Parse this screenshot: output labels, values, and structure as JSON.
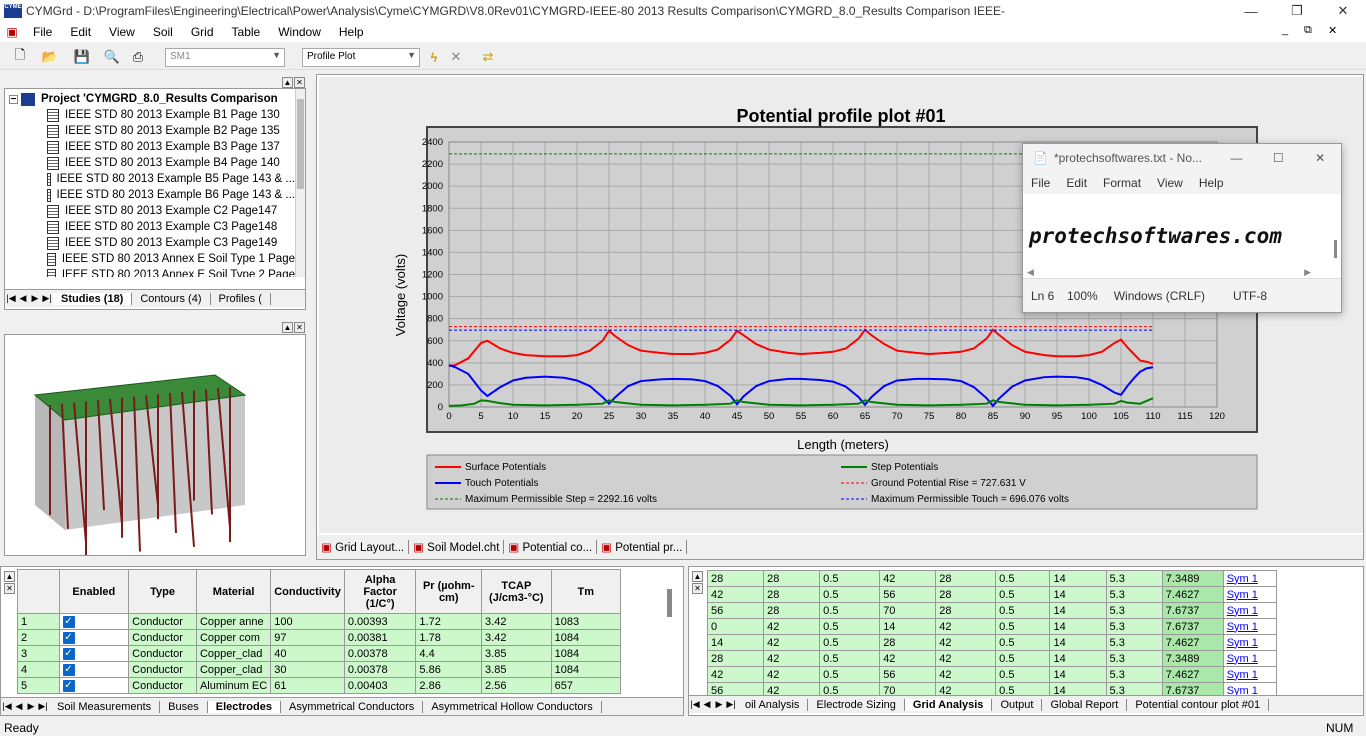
{
  "window": {
    "title": "CYMGrd - D:\\ProgramFiles\\Engineering\\Electrical\\Power\\Analysis\\Cyme\\CYMGRD\\V8.0Rev01\\CYMGRD-IEEE-80 2013 Results Comparison\\CYMGRD_8.0_Results Comparison IEEE-",
    "minimize": "—",
    "maximize": "❐",
    "close": "✕",
    "app_icon_text": "CYME"
  },
  "menu": [
    "File",
    "Edit",
    "View",
    "Soil",
    "Grid",
    "Table",
    "Window",
    "Help"
  ],
  "mdi_buttons": {
    "min": "_",
    "restore": "⧉",
    "close": "✕"
  },
  "toolbar": {
    "combo1": "SM1",
    "combo2": "Profile Plot"
  },
  "tree": {
    "project": "Project 'CYMGRD_8.0_Results Comparison",
    "items": [
      "IEEE STD 80 2013 Example B1 Page 130",
      "IEEE STD 80 2013 Example B2 Page 135",
      "IEEE STD 80 2013 Example B3 Page 137",
      "IEEE STD 80 2013 Example B4 Page 140",
      "IEEE STD 80 2013 Example B5 Page 143 & ...",
      "IEEE STD 80 2013 Example B6 Page 143 & ...",
      "IEEE STD 80 2013 Example C2 Page147",
      "IEEE STD 80 2013 Example C3 Page148",
      "IEEE STD 80 2013 Example C3 Page149",
      "IEEE STD 80 2013 Annex E Soil Type 1 Page",
      "IEEE STD 80 2013 Annex E Soil Type 2 Page"
    ],
    "tabs": [
      "Studies (18)",
      "Contours (4)",
      "Profiles ("
    ]
  },
  "doc_tabs": [
    "Grid Layout...",
    "Soil Model.cht",
    "Potential co...",
    "Potential pr..."
  ],
  "chart_data": {
    "type": "line",
    "title": "Potential profile plot #01",
    "xlabel": "Length (meters)",
    "ylabel": "Voltage (volts)",
    "xlim": [
      0,
      120
    ],
    "ylim": [
      0,
      2400
    ],
    "xticks": [
      "0",
      "5",
      "10",
      "15",
      "20",
      "25",
      "30",
      "35",
      "40",
      "45",
      "50",
      "55",
      "60",
      "65",
      "70",
      "75",
      "80",
      "85",
      "90",
      "95",
      "100",
      "105",
      "110",
      "115",
      "120"
    ],
    "yticks": [
      "0",
      "200",
      "400",
      "600",
      "800",
      "1000",
      "1200",
      "1400",
      "1600",
      "1800",
      "2000",
      "2200",
      "2400"
    ],
    "grid": true,
    "series": [
      {
        "name": "Surface Potentials",
        "color": "#ff0000",
        "x": [
          0,
          1,
          3,
          5,
          6,
          8,
          10,
          12,
          15,
          18,
          20,
          22,
          24,
          25,
          26,
          28,
          30,
          33,
          35,
          38,
          40,
          42,
          44,
          45,
          46,
          48,
          50,
          53,
          55,
          58,
          60,
          62,
          64,
          65,
          66,
          68,
          70,
          73,
          75,
          78,
          80,
          82,
          84,
          85,
          86,
          88,
          90,
          93,
          95,
          98,
          100,
          102,
          104,
          105,
          106,
          107,
          108,
          109,
          110
        ],
        "y": [
          370,
          380,
          440,
          580,
          600,
          530,
          490,
          470,
          460,
          460,
          470,
          510,
          600,
          690,
          640,
          560,
          510,
          490,
          480,
          480,
          490,
          520,
          610,
          690,
          650,
          570,
          520,
          490,
          480,
          490,
          500,
          530,
          620,
          700,
          650,
          570,
          510,
          490,
          480,
          490,
          500,
          530,
          620,
          700,
          650,
          560,
          500,
          470,
          460,
          460,
          470,
          500,
          580,
          610,
          540,
          480,
          420,
          410,
          390
        ]
      },
      {
        "name": "Touch Potentials",
        "color": "#0000ff",
        "x": [
          0,
          1,
          3,
          5,
          6,
          8,
          10,
          12,
          15,
          18,
          20,
          22,
          24,
          25,
          26,
          28,
          30,
          33,
          35,
          38,
          40,
          42,
          44,
          45,
          46,
          48,
          50,
          53,
          55,
          58,
          60,
          62,
          64,
          65,
          66,
          68,
          70,
          73,
          75,
          78,
          80,
          82,
          84,
          85,
          86,
          88,
          90,
          93,
          95,
          98,
          100,
          102,
          104,
          105,
          106,
          107,
          108,
          109,
          110
        ],
        "y": [
          380,
          360,
          300,
          150,
          100,
          180,
          240,
          265,
          275,
          265,
          240,
          190,
          90,
          30,
          90,
          190,
          235,
          250,
          255,
          250,
          235,
          190,
          100,
          25,
          95,
          190,
          235,
          255,
          255,
          245,
          230,
          185,
          90,
          20,
          90,
          190,
          240,
          255,
          255,
          250,
          235,
          180,
          80,
          10,
          80,
          185,
          240,
          270,
          275,
          270,
          250,
          200,
          130,
          110,
          190,
          260,
          320,
          350,
          360
        ]
      },
      {
        "name": "Step Potentials",
        "color": "#008000",
        "x": [
          0,
          2,
          4,
          5,
          6,
          8,
          10,
          15,
          20,
          24,
          25,
          26,
          30,
          35,
          40,
          44,
          45,
          46,
          50,
          55,
          60,
          64,
          65,
          66,
          70,
          75,
          80,
          84,
          85,
          86,
          90,
          95,
          100,
          104,
          105,
          106,
          108,
          110
        ],
        "y": [
          10,
          15,
          30,
          60,
          55,
          35,
          20,
          15,
          20,
          30,
          60,
          45,
          20,
          15,
          20,
          30,
          60,
          45,
          20,
          15,
          20,
          30,
          60,
          45,
          20,
          15,
          20,
          30,
          60,
          45,
          20,
          15,
          20,
          30,
          55,
          40,
          30,
          80
        ]
      },
      {
        "name": "Ground Potential Rise = 727.631 V",
        "color": "#ff0000",
        "dashed": true,
        "y": 727.631
      },
      {
        "name": "Maximum Permissible Step = 2292.16 volts",
        "color": "#008000",
        "dashed": true,
        "y": 2292.16
      },
      {
        "name": "Maximum Permissible Touch = 696.076 volts",
        "color": "#0000ff",
        "dashed": true,
        "y": 696.076
      }
    ]
  },
  "legend": [
    {
      "label": "Surface Potentials",
      "color": "#ff0000",
      "style": "solid"
    },
    {
      "label": "Step Potentials",
      "color": "#008000",
      "style": "solid"
    },
    {
      "label": "Touch Potentials",
      "color": "#0000ff",
      "style": "solid"
    },
    {
      "label": "Ground Potential Rise = 727.631 V",
      "color": "#ff0000",
      "style": "dashed"
    },
    {
      "label": "Maximum Permissible Step = 2292.16 volts",
      "color": "#008000",
      "style": "dashed"
    },
    {
      "label": "Maximum Permissible Touch = 696.076 volts",
      "color": "#0000ff",
      "style": "dashed"
    }
  ],
  "notepad": {
    "title": "*protechsoftwares.txt - No...",
    "menu": [
      "File",
      "Edit",
      "Format",
      "View",
      "Help"
    ],
    "content": "protechsoftwares.com",
    "status": [
      "Ln 6",
      "100%",
      "Windows (CRLF)",
      "UTF-8"
    ],
    "min": "—",
    "max": "☐",
    "close": "✕"
  },
  "electrodes": {
    "headers": [
      "Enabled",
      "Type",
      "Material",
      "Conductivity",
      "Alpha Factor (1/C°)",
      "Pr (µohm-cm)",
      "TCAP (J/cm3-°C)",
      "Tm"
    ],
    "rows": [
      [
        "1",
        "Conductor",
        "Copper anne",
        "100",
        "0.00393",
        "1.72",
        "3.42",
        "1083"
      ],
      [
        "2",
        "Conductor",
        "Copper com",
        "97",
        "0.00381",
        "1.78",
        "3.42",
        "1084"
      ],
      [
        "3",
        "Conductor",
        "Copper_clad",
        "40",
        "0.00378",
        "4.4",
        "3.85",
        "1084"
      ],
      [
        "4",
        "Conductor",
        "Copper_clad",
        "30",
        "0.00378",
        "5.86",
        "3.85",
        "1084"
      ],
      [
        "5",
        "Conductor",
        "Aluminum EC",
        "61",
        "0.00403",
        "2.86",
        "2.56",
        "657"
      ]
    ],
    "tabs": [
      "Soil Measurements",
      "Buses",
      "Electrodes",
      "Asymmetrical Conductors",
      "Asymmetrical Hollow Conductors"
    ]
  },
  "grid_analysis": {
    "rows": [
      [
        "28",
        "28",
        "0.5",
        "42",
        "28",
        "0.5",
        "14",
        "5.3",
        "7.3489",
        "Sym 1"
      ],
      [
        "42",
        "28",
        "0.5",
        "56",
        "28",
        "0.5",
        "14",
        "5.3",
        "7.4627",
        "Sym 1"
      ],
      [
        "56",
        "28",
        "0.5",
        "70",
        "28",
        "0.5",
        "14",
        "5.3",
        "7.6737",
        "Sym 1"
      ],
      [
        "0",
        "42",
        "0.5",
        "14",
        "42",
        "0.5",
        "14",
        "5.3",
        "7.6737",
        "Sym 1"
      ],
      [
        "14",
        "42",
        "0.5",
        "28",
        "42",
        "0.5",
        "14",
        "5.3",
        "7.4627",
        "Sym 1"
      ],
      [
        "28",
        "42",
        "0.5",
        "42",
        "42",
        "0.5",
        "14",
        "5.3",
        "7.3489",
        "Sym 1"
      ],
      [
        "42",
        "42",
        "0.5",
        "56",
        "42",
        "0.5",
        "14",
        "5.3",
        "7.4627",
        "Sym 1"
      ],
      [
        "56",
        "42",
        "0.5",
        "70",
        "42",
        "0.5",
        "14",
        "5.3",
        "7.6737",
        "Sym 1"
      ]
    ],
    "tabs": [
      "oil Analysis",
      "Electrode Sizing",
      "Grid Analysis",
      "Output",
      "Global Report",
      "Potential contour plot #01"
    ]
  },
  "status": {
    "left": "Ready",
    "right": "NUM"
  }
}
